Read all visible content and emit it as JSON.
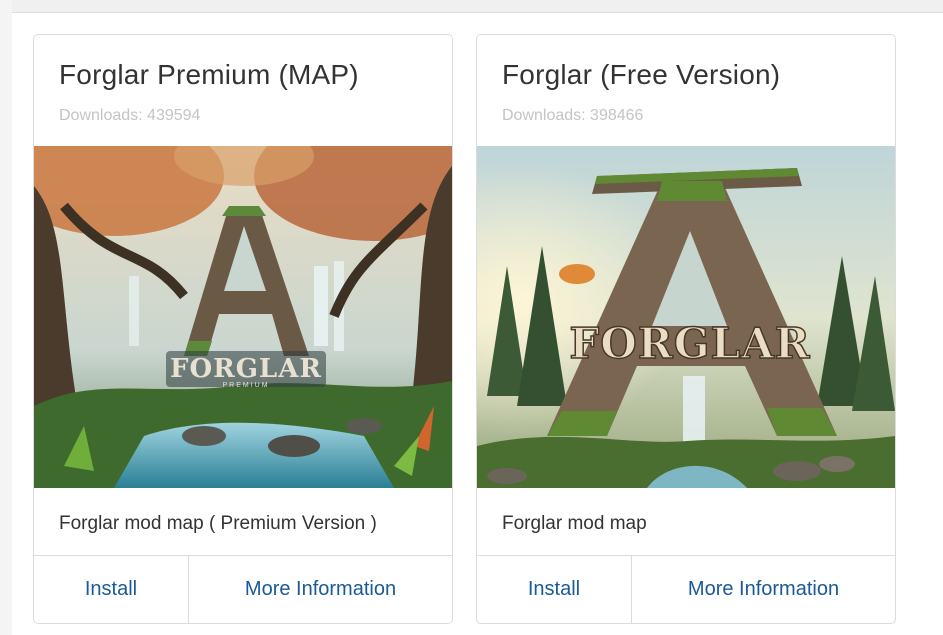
{
  "cards": [
    {
      "title": "Forglar Premium (MAP)",
      "downloads": "Downloads: 439594",
      "image_wordmark": "FORGLAR",
      "image_subtext": "PREMIUM",
      "description": "Forglar mod map ( Premium Version )",
      "install_label": "Install",
      "more_label": "More Information"
    },
    {
      "title": "Forglar (Free Version)",
      "downloads": "Downloads: 398466",
      "image_wordmark": "FORGLAR",
      "description": "Forglar mod map",
      "install_label": "Install",
      "more_label": "More Information"
    }
  ],
  "colors": {
    "link": "#1a5a96",
    "muted": "#c4c4c4",
    "border": "#dcdcdc"
  }
}
